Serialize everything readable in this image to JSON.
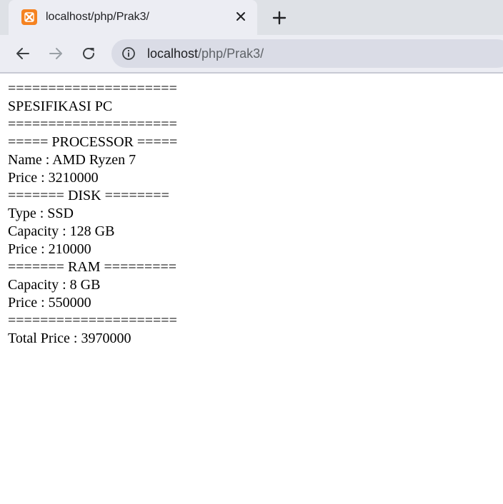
{
  "browser": {
    "tab": {
      "title": "localhost/php/Prak3/",
      "favicon": "xampp-icon",
      "favicon_color": "#f58220"
    },
    "new_tab_icon": "plus-icon",
    "nav": {
      "back_icon": "arrow-left-icon",
      "forward_icon": "arrow-right-icon",
      "reload_icon": "reload-icon"
    },
    "address_bar": {
      "info_icon": "info-icon",
      "url_host": "localhost",
      "url_path": "/php/Prak3/"
    }
  },
  "page": {
    "lines": [
      "=====================",
      "SPESIFIKASI PC",
      "=====================",
      "===== PROCESSOR =====",
      "Name : AMD Ryzen 7",
      "Price : 3210000",
      "======= DISK ========",
      "Type : SSD",
      "Capacity : 128 GB",
      "Price : 210000",
      "======= RAM =========",
      "Capacity : 8 GB",
      "Price : 550000",
      "=====================",
      "Total Price : 3970000"
    ]
  }
}
